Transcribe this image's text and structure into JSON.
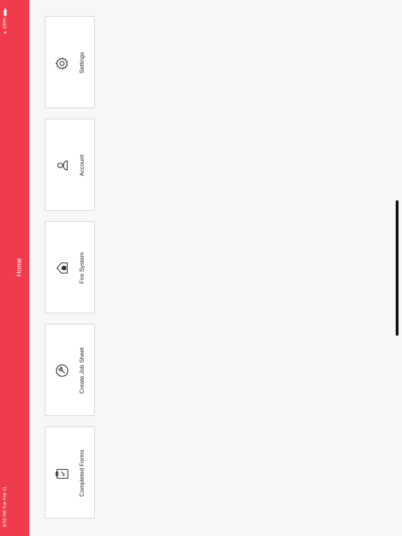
{
  "status_bar": {
    "time_date": "8:52 AM   Tue Feb 11",
    "battery": "100%"
  },
  "nav": {
    "title": "Home"
  },
  "tiles": [
    {
      "label": "Settings",
      "icon": "gear-icon"
    },
    {
      "label": "Account",
      "icon": "user-icon"
    },
    {
      "label": "Fire System",
      "icon": "house-fire-icon"
    },
    {
      "label": "Create Job Sheet",
      "icon": "wrench-circle-icon"
    },
    {
      "label": "Completed Forms",
      "icon": "clipboard-check-icon"
    }
  ],
  "colors": {
    "accent": "#ef3b4c",
    "background": "#f7f7f9",
    "card": "#ffffff"
  }
}
